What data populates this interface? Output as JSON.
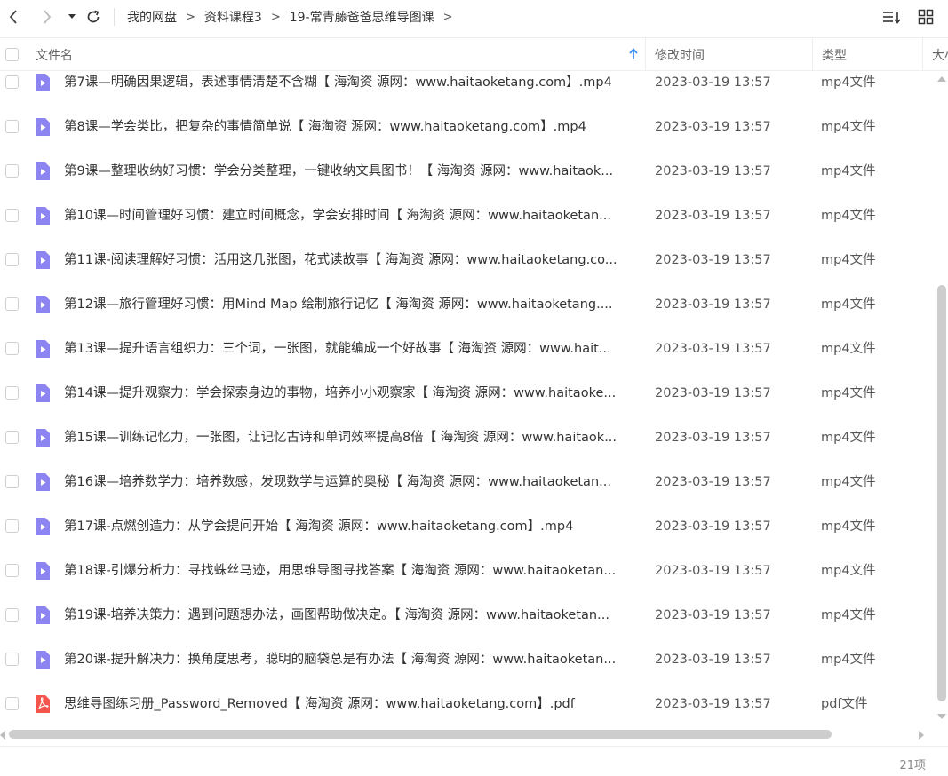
{
  "toolbar": {
    "icons": {
      "back": "chevron-left-icon",
      "forward": "chevron-right-icon",
      "history": "caret-down-icon",
      "refresh": "refresh-icon",
      "sort": "sort-list-icon",
      "view": "grid-view-icon"
    },
    "breadcrumb": [
      "我的网盘",
      "资料课程3",
      "19-常青藤爸爸思维导图课"
    ],
    "crumb_sep": ">"
  },
  "header": {
    "name": "文件名",
    "modified": "修改时间",
    "type": "类型",
    "size": "大小",
    "sort_icon": "sort-ascending-arrow-icon"
  },
  "files": [
    {
      "name": "第7课—明确因果逻辑，表述事情清楚不含糊【 海淘资 源网：www.haitaoketang.com】.mp4",
      "modified": "2023-03-19 13:57",
      "type": "mp4文件",
      "icon": "video-file-icon"
    },
    {
      "name": "第8课—学会类比，把复杂的事情简单说【 海淘资 源网：www.haitaoketang.com】.mp4",
      "modified": "2023-03-19 13:57",
      "type": "mp4文件",
      "icon": "video-file-icon"
    },
    {
      "name": "第9课—整理收纳好习惯：学会分类整理，一键收纳文具图书！【 海淘资 源网：www.haitaok...",
      "modified": "2023-03-19 13:57",
      "type": "mp4文件",
      "icon": "video-file-icon"
    },
    {
      "name": "第10课—时间管理好习惯：建立时间概念，学会安排时间【 海淘资 源网：www.haitaoketan...",
      "modified": "2023-03-19 13:57",
      "type": "mp4文件",
      "icon": "video-file-icon"
    },
    {
      "name": "第11课-阅读理解好习惯：活用这几张图，花式读故事【 海淘资 源网：www.haitaoketang.co...",
      "modified": "2023-03-19 13:57",
      "type": "mp4文件",
      "icon": "video-file-icon"
    },
    {
      "name": "第12课—旅行管理好习惯：用Mind Map 绘制旅行记忆【 海淘资 源网：www.haitaoketang....",
      "modified": "2023-03-19 13:57",
      "type": "mp4文件",
      "icon": "video-file-icon"
    },
    {
      "name": "第13课—提升语言组织力：三个词，一张图，就能编成一个好故事【 海淘资 源网：www.hait...",
      "modified": "2023-03-19 13:57",
      "type": "mp4文件",
      "icon": "video-file-icon"
    },
    {
      "name": "第14课—提升观察力：学会探索身边的事物，培养小小观察家【 海淘资 源网：www.haitaoke...",
      "modified": "2023-03-19 13:57",
      "type": "mp4文件",
      "icon": "video-file-icon"
    },
    {
      "name": "第15课—训练记忆力，一张图，让记忆古诗和单词效率提高8倍【 海淘资 源网：www.haitaok...",
      "modified": "2023-03-19 13:57",
      "type": "mp4文件",
      "icon": "video-file-icon"
    },
    {
      "name": "第16课—培养数学力：培养数感，发现数学与运算的奥秘【 海淘资 源网：www.haitaoketan...",
      "modified": "2023-03-19 13:57",
      "type": "mp4文件",
      "icon": "video-file-icon"
    },
    {
      "name": "第17课-点燃创造力：从学会提问开始【 海淘资 源网：www.haitaoketang.com】.mp4",
      "modified": "2023-03-19 13:57",
      "type": "mp4文件",
      "icon": "video-file-icon"
    },
    {
      "name": "第18课-引爆分析力：寻找蛛丝马迹，用思维导图寻找答案【 海淘资 源网：www.haitaoketan...",
      "modified": "2023-03-19 13:57",
      "type": "mp4文件",
      "icon": "video-file-icon"
    },
    {
      "name": "第19课-培养决策力：遇到问题想办法，画图帮助做决定。【 海淘资 源网：www.haitaoketan...",
      "modified": "2023-03-19 13:57",
      "type": "mp4文件",
      "icon": "video-file-icon"
    },
    {
      "name": "第20课-提升解决力：换角度思考，聪明的脑袋总是有办法【 海淘资 源网：www.haitaoketan...",
      "modified": "2023-03-19 13:57",
      "type": "mp4文件",
      "icon": "video-file-icon"
    },
    {
      "name": "思维导图练习册_Password_Removed【 海淘资 源网：www.haitaoketang.com】.pdf",
      "modified": "2023-03-19 13:57",
      "type": "pdf文件",
      "icon": "pdf-file-icon"
    }
  ],
  "colors": {
    "video_icon": "#8c84f0",
    "pdf_icon": "#f4564e",
    "sort_arrow": "#3b8cf4"
  },
  "scroll": {
    "vertical_position": 0.33,
    "vertical_visible": 0.68,
    "horizontal_position": 0.0,
    "horizontal_visible": 0.91
  },
  "status": {
    "count": "21项"
  }
}
